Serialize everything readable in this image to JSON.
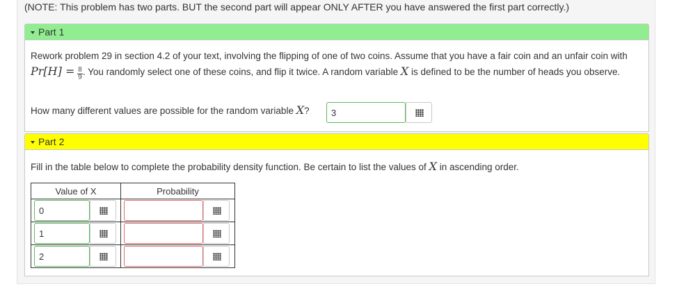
{
  "note": "(NOTE: This problem has two parts. BUT the second part will appear ONLY AFTER you have answered the first part correctly.)",
  "part1": {
    "header": "Part 1",
    "prompt_a": "Rework problem 29 in section 4.2 of your text, involving the flipping of one of two coins. Assume that you have a fair coin and an unfair coin with ",
    "pr_expr": "Pr[H] =",
    "frac_num": "8",
    "frac_den": "9",
    "prompt_b": ". You randomly select one of these coins, and flip it twice. A random variable ",
    "var": "X",
    "prompt_c": " is defined to be the number of heads you observe.",
    "question_a": "How many different values are possible for the random variable ",
    "question_b": "?",
    "answer_value": "3"
  },
  "part2": {
    "header": "Part 2",
    "instr_a": "Fill in the table below to complete the probability density function. Be certain to list the values of ",
    "var": "X",
    "instr_b": " in ascending order.",
    "table": {
      "headers": [
        "Value of X",
        "Probability"
      ],
      "rows": [
        {
          "value": "0",
          "probability": ""
        },
        {
          "value": "1",
          "probability": ""
        },
        {
          "value": "2",
          "probability": ""
        }
      ]
    }
  },
  "icons": {
    "palette": "grid-icon"
  },
  "colors": {
    "part1_header": "#90ee90",
    "part2_header": "#ffff00",
    "correct_border": "#5cb85c",
    "incorrect_border": "#e06b6b"
  }
}
